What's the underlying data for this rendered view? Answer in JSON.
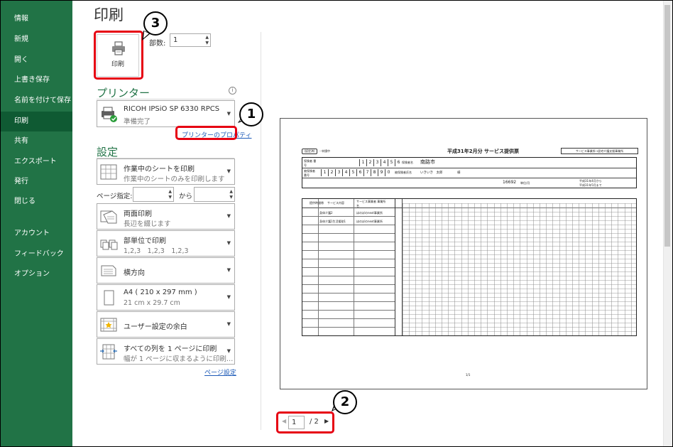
{
  "sidebar": {
    "items": [
      "情報",
      "新規",
      "開く",
      "上書き保存",
      "名前を付けて保存",
      "印刷",
      "共有",
      "エクスポート",
      "発行",
      "閉じる",
      "アカウント",
      "フィードバック",
      "オプション"
    ],
    "active": "印刷"
  },
  "page_title": "印刷",
  "print_button": {
    "label": "印刷"
  },
  "copies": {
    "label": "部数:",
    "value": "1"
  },
  "printer": {
    "heading": "プリンター",
    "name": "RICOH IPSiO SP 6330 RPCS",
    "status": "準備完了",
    "properties_link": "プリンターのプロパティ"
  },
  "settings": {
    "heading": "設定",
    "print_what": {
      "line1": "作業中のシートを印刷",
      "line2": "作業中のシートのみを印刷します"
    },
    "pages_label": "ページ指定:",
    "to_label": "から",
    "sides": {
      "line1": "両面印刷",
      "line2": "長辺を綴じます"
    },
    "collate": {
      "line1": "部単位で印刷",
      "line2": "1,2,3　1,2,3　1,2,3"
    },
    "orientation": {
      "line1": "横方向"
    },
    "paper": {
      "line1": "A4 ( 210 x 297 mm )",
      "line2": "21 cm x 29.7 cm"
    },
    "margins": {
      "line1": "ユーザー設定の余白"
    },
    "scaling": {
      "line1": "すべての列を 1 ページに印刷",
      "line2": "幅が 1 ページに収まるように印刷…"
    },
    "page_setup_link": "ページ設定"
  },
  "pager": {
    "current": "1",
    "total": "/ 2"
  },
  "annotations": [
    "1",
    "2",
    "3"
  ],
  "colors": {
    "sidebar": "#217346",
    "accent": "#217346",
    "highlight": "#e60012",
    "link": "#1e5bb8"
  },
  "document": {
    "title": "平成31年2月分 サービス提供票",
    "top_left_tag": "(認定済)",
    "top_left_note": "・申請中",
    "top_right_tag": "サービス事業所→居宅介護支援事業所",
    "insurer_no_label": "保険者 番号",
    "insurer_no_digits": [
      "1",
      "2",
      "3",
      "4",
      "5",
      "6"
    ],
    "insurer_name_label": "保険者名",
    "insurer_name": "南路市",
    "insured_no_label": "被保険者 番号",
    "insured_no_digits": [
      "1",
      "2",
      "3",
      "4",
      "5",
      "6",
      "7",
      "8",
      "9",
      "0"
    ],
    "insured_name_label": "被保険者氏名",
    "insured_name": "いきいき　太郎",
    "honorific": "様",
    "units": "16692",
    "units_suffix": "単位/月",
    "period_from": "平成31年4月から",
    "period_to": "平成31年5月まで",
    "schedule_heading": "提供時間帯",
    "service_col": "サービス内容",
    "provider_col": "サービス事業者 事業所名",
    "rows": [
      {
        "service": "身体介護2",
        "provider": "ほのぼのnext事業所"
      },
      {
        "service": "身体介護1生活援助1",
        "provider": "ほのぼのnext事業所"
      }
    ],
    "footer": "1/1"
  }
}
